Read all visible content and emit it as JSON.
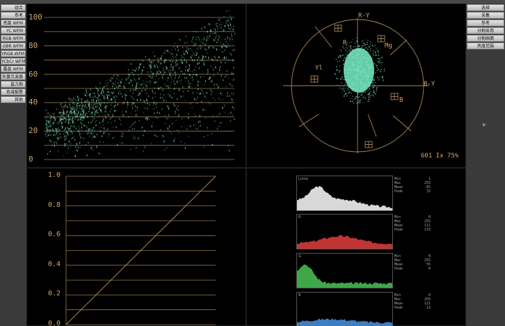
{
  "left_menu": {
    "items": [
      "组合",
      "参考",
      "亮度 WFM",
      "YC WFM",
      "RGB WFM",
      "GBR WFM",
      "YRGB WFM",
      "YCbCr WFM",
      "覆盖 WFM",
      "矢量示波器",
      "直方图",
      "色域报警",
      "其他"
    ]
  },
  "right_menu": {
    "items": [
      "选择",
      "采集",
      "参考",
      "分割采用",
      "分割画面",
      "亮度范围"
    ],
    "arrow": "▶"
  },
  "waveform": {
    "ticks": [
      "100",
      "80",
      "60",
      "40",
      "20",
      "0"
    ]
  },
  "vectorscope": {
    "labels": {
      "ry": "R-Y",
      "by": "B-Y",
      "r": "R",
      "mg": "Mg",
      "yl": "Yl",
      "b": "B"
    },
    "footer": "601 Ix 75%"
  },
  "curve": {
    "ticks": [
      "1.0",
      "0.8",
      "0.6",
      "0.4",
      "0.2",
      "0.0"
    ]
  },
  "histograms": [
    {
      "tag": "Luma",
      "color": "#d8d8d8",
      "stats": [
        [
          "Min",
          "1"
        ],
        [
          "Max",
          "255"
        ],
        [
          "Mean",
          "65"
        ],
        [
          "Peak",
          "33"
        ]
      ]
    },
    {
      "tag": "R",
      "color": "#c23434",
      "stats": [
        [
          "Min",
          "0"
        ],
        [
          "Max",
          "255"
        ],
        [
          "Mean",
          "111"
        ],
        [
          "Peak",
          "133"
        ]
      ]
    },
    {
      "tag": "G",
      "color": "#3fa64a",
      "stats": [
        [
          "Min",
          "0"
        ],
        [
          "Max",
          "255"
        ],
        [
          "Mean",
          "55"
        ],
        [
          "Peak",
          "0"
        ]
      ]
    },
    {
      "tag": "B",
      "color": "#3c7ec4",
      "stats": [
        [
          "Min",
          "0"
        ],
        [
          "Max",
          "255"
        ],
        [
          "Mean",
          "121"
        ],
        [
          "Peak",
          "13"
        ]
      ]
    }
  ],
  "colors": {
    "graticule": "#c9a06a",
    "trace": "#7fe0c0",
    "accent": "#d6a76c"
  }
}
